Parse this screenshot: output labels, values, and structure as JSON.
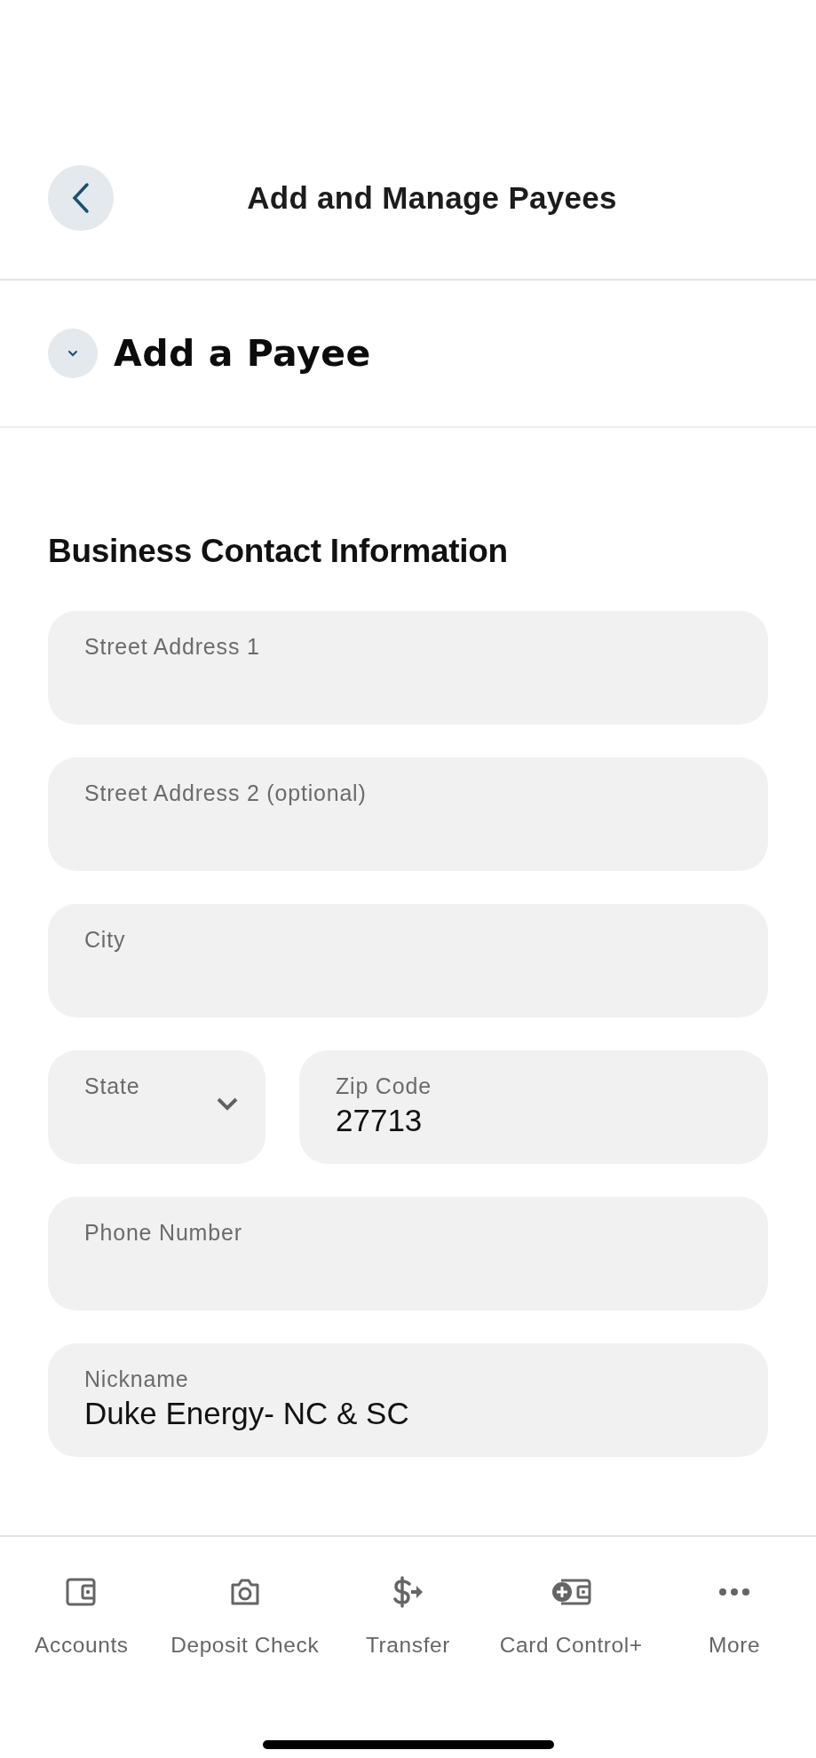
{
  "header": {
    "title": "Add and Manage Payees"
  },
  "section": {
    "title": "Add a Payee",
    "expanded": true
  },
  "form": {
    "heading": "Business Contact Information",
    "rows": [
      [
        {
          "kind": "text",
          "label": "Street Address 1"
        }
      ],
      [
        {
          "kind": "text",
          "label": "Street Address 2 (optional)"
        }
      ],
      [
        {
          "kind": "text",
          "label": "City"
        }
      ],
      [
        {
          "kind": "select",
          "label": "State"
        },
        {
          "kind": "text",
          "label": "Zip Code",
          "value": "27713"
        }
      ],
      [
        {
          "kind": "text",
          "label": "Phone Number"
        }
      ],
      [
        {
          "kind": "text",
          "label": "Nickname",
          "value": "Duke Energy- NC & SC"
        }
      ]
    ]
  },
  "tab_bar": [
    {
      "label": "Accounts"
    },
    {
      "label": "Deposit Check"
    },
    {
      "label": "Transfer"
    },
    {
      "label": "Card Control+"
    },
    {
      "label": "More"
    }
  ]
}
